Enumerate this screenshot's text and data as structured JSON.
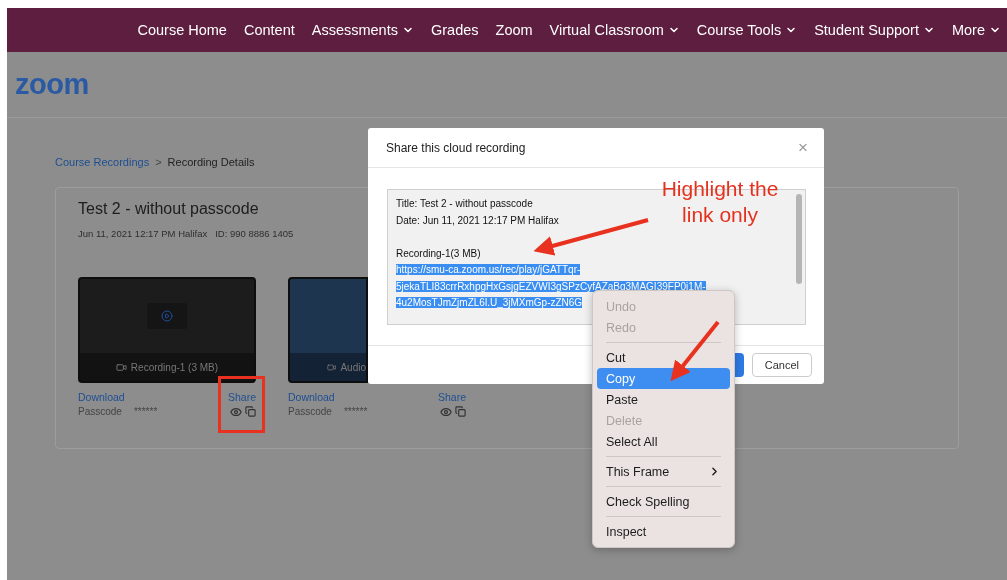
{
  "nav": {
    "items": [
      {
        "label": "Course Home",
        "has_menu": false
      },
      {
        "label": "Content",
        "has_menu": false
      },
      {
        "label": "Assessments",
        "has_menu": true
      },
      {
        "label": "Grades",
        "has_menu": false
      },
      {
        "label": "Zoom",
        "has_menu": false
      },
      {
        "label": "Virtual Classroom",
        "has_menu": true
      },
      {
        "label": "Course Tools",
        "has_menu": true
      },
      {
        "label": "Student Support",
        "has_menu": true
      },
      {
        "label": "More",
        "has_menu": true
      }
    ]
  },
  "logo": "zoom",
  "breadcrumb": {
    "items": [
      {
        "label": "Course Recordings",
        "link": true
      },
      {
        "label": "Recording Details",
        "link": false
      }
    ],
    "separator": ">"
  },
  "recording": {
    "title": "Test 2 - without passcode",
    "date": "Jun 11, 2021 12:17 PM Halifax",
    "id": "ID: 990 8886 1405"
  },
  "files": [
    {
      "kind": "video",
      "label": "Recording-1 (3 MB)",
      "download": "Download",
      "passcode_label": "Passcode",
      "passcode": "******",
      "share": "Share",
      "annotated": true
    },
    {
      "kind": "audio",
      "label": "Audio",
      "download": "Download",
      "passcode_label": "Passcode",
      "passcode": "******",
      "share": "Share",
      "annotated": false
    }
  ],
  "dialog": {
    "title": "Share this cloud recording",
    "close": "×",
    "info_lines": [
      "Title: Test 2 - without passcode",
      "Date: Jun 11, 2021 12:17 PM Halifax"
    ],
    "recording_name": "Recording-1(3 MB)",
    "link": {
      "selected": true,
      "lines": [
        "https://smu-ca.zoom.us/rec/play/jGATTqr-",
        "5jekaTLI83crrRxhpgHxGsjgEZVWI3gSPzCyfAZaBg3MAGI39FP0i1M-",
        "4u2MosTJmZjmZL6l.U_3jMXmGp-zZN6G"
      ]
    },
    "cancel": "Cancel"
  },
  "context_menu": {
    "items": [
      {
        "kind": "item",
        "label": "Undo",
        "disabled": true,
        "selected": false
      },
      {
        "kind": "item",
        "label": "Redo",
        "disabled": true,
        "selected": false
      },
      {
        "kind": "separator"
      },
      {
        "kind": "item",
        "label": "Cut",
        "disabled": false,
        "selected": false
      },
      {
        "kind": "item",
        "label": "Copy",
        "disabled": false,
        "selected": true
      },
      {
        "kind": "item",
        "label": "Paste",
        "disabled": false,
        "selected": false
      },
      {
        "kind": "item",
        "label": "Delete",
        "disabled": true,
        "selected": false
      },
      {
        "kind": "item",
        "label": "Select All",
        "disabled": false,
        "selected": false
      },
      {
        "kind": "separator"
      },
      {
        "kind": "submenu",
        "label": "This Frame",
        "disabled": false,
        "selected": false
      },
      {
        "kind": "separator"
      },
      {
        "kind": "item",
        "label": "Check Spelling",
        "disabled": false,
        "selected": false
      },
      {
        "kind": "separator"
      },
      {
        "kind": "item",
        "label": "Inspect",
        "disabled": false,
        "selected": false
      }
    ]
  },
  "annotation": {
    "text": "Highlight the link only"
  }
}
